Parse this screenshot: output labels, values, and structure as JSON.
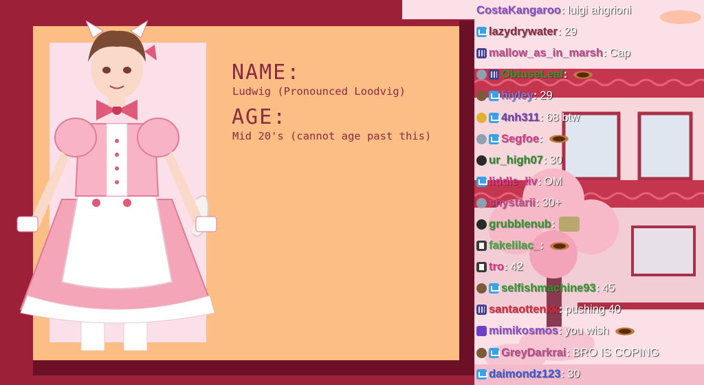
{
  "profile": {
    "name_label": "NAME:",
    "name_value": "Ludwig (Pronounced Loodvig)",
    "age_label": "AGE:",
    "age_value": "Mid 20's (cannot age past this)"
  },
  "colors": {
    "background": "#9b2038",
    "card": "#fdbe85",
    "portrait_bg": "#fbe0ea",
    "text": "#8a2a40",
    "chat_panel": "#fbe0e8"
  },
  "chat": {
    "messages": [
      {
        "badges": [],
        "user": "CostaKangaroo",
        "color": "#8a4cc9",
        "text": "luigi ahgrioni"
      },
      {
        "badges": [
          "crown"
        ],
        "user": "lazydrywater",
        "color": "#8a2a40",
        "text": "29"
      },
      {
        "badges": [
          "month"
        ],
        "user": "mallow_as_in_marsh",
        "color": "#c04a8a",
        "text": "Cap"
      },
      {
        "badges": [
          "emote-light",
          "month"
        ],
        "user": "ObtuseLeaf",
        "color": "#2e9a2e",
        "text": "",
        "emote": "emote"
      },
      {
        "badges": [
          "emote",
          "crown"
        ],
        "user": "hiyley",
        "color": "#7a7ad8",
        "text": "29"
      },
      {
        "badges": [
          "gold",
          "crown"
        ],
        "user": "4nh311",
        "color": "#6b3fb0",
        "text": "68 btw"
      },
      {
        "badges": [
          "emote-light",
          "crown"
        ],
        "user": "Segfoe",
        "color": "#d83a8a",
        "text": "",
        "emote": "emote"
      },
      {
        "badges": [
          "emote-dark"
        ],
        "user": "ur_high07",
        "color": "#2e8a2e",
        "text": "30"
      },
      {
        "badges": [
          "crown"
        ],
        "user": "liddle_liv",
        "color": "#d83a8a",
        "text": "OM"
      },
      {
        "badges": [
          "emote-light"
        ],
        "user": "shystarii",
        "color": "#c04a8a",
        "text": "30+"
      },
      {
        "badges": [
          "emote-dark"
        ],
        "user": "grubblenub",
        "color": "#2e9a2e",
        "text": "",
        "emote": "image"
      },
      {
        "badges": [
          "glitch"
        ],
        "user": "fakelilac_",
        "color": "#3fae3f",
        "text": "",
        "emote": "emote"
      },
      {
        "badges": [
          "glitch"
        ],
        "user": "tro",
        "color": "#d83a8a",
        "text": "42"
      },
      {
        "badges": [
          "emote",
          "crown"
        ],
        "user": "selfishmachine93",
        "color": "#2e9a2e",
        "text": "45"
      },
      {
        "badges": [
          "month"
        ],
        "user": "santaottenkk",
        "color": "#d8283a",
        "text": "pushing 40"
      },
      {
        "badges": [
          "prime"
        ],
        "user": "mimikosmos",
        "color": "#8a4cc9",
        "text": "you wish",
        "emote": "emote"
      },
      {
        "badges": [
          "emote",
          "crown"
        ],
        "user": "GreyDarkrai",
        "color": "#c04a8a",
        "text": "BRO IS COPING"
      },
      {
        "badges": [
          "crown"
        ],
        "user": "daimondz123",
        "color": "#3a5ad8",
        "text": "30"
      }
    ]
  }
}
